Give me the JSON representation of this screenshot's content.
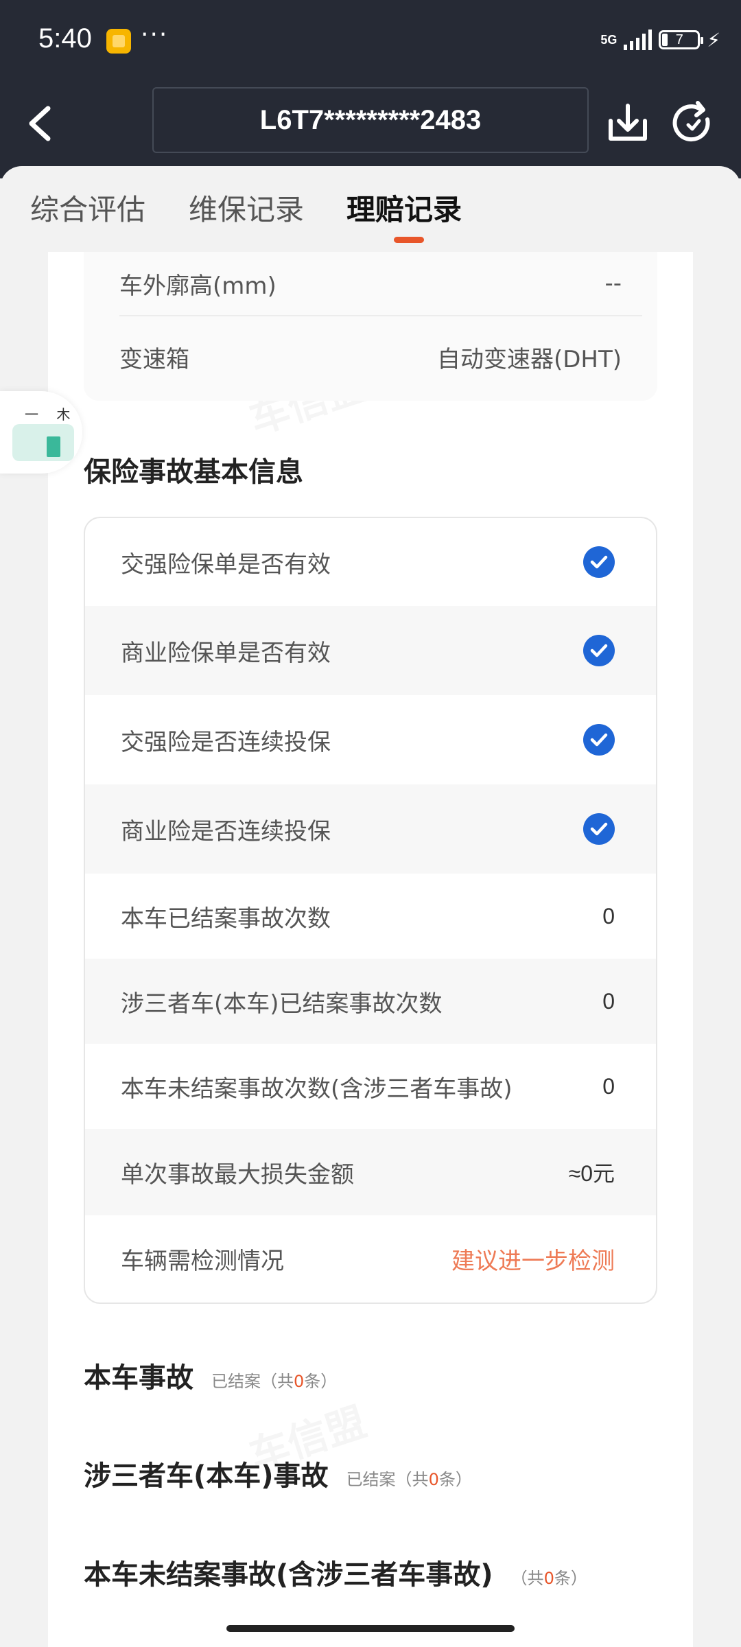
{
  "status_bar": {
    "time": "5:40",
    "dots": "···",
    "network": "5G",
    "battery": "7"
  },
  "header": {
    "vin": "L6T7*********2483"
  },
  "tabs": [
    {
      "label": "综合评估"
    },
    {
      "label": "维保记录"
    },
    {
      "label": "理赔记录"
    }
  ],
  "vehicle_info": {
    "rows": [
      {
        "label": "车外廓高(mm)",
        "value": "--"
      },
      {
        "label": "变速箱",
        "value": "自动变速器(DHT)"
      }
    ]
  },
  "floating_widget": {
    "text": "一 木"
  },
  "insurance": {
    "title": "保险事故基本信息",
    "rows": [
      {
        "label": "交强险保单是否有效",
        "type": "check"
      },
      {
        "label": "商业险保单是否有效",
        "type": "check"
      },
      {
        "label": "交强险是否连续投保",
        "type": "check"
      },
      {
        "label": "商业险是否连续投保",
        "type": "check"
      },
      {
        "label": "本车已结案事故次数",
        "value": "0"
      },
      {
        "label": "涉三者车(本车)已结案事故次数",
        "value": "0"
      },
      {
        "label": "本车未结案事故次数(含涉三者车事故)",
        "value": "0"
      },
      {
        "label": "单次事故最大损失金额",
        "value": "≈0元"
      },
      {
        "label": "车辆需检测情况",
        "value": "建议进一步检测"
      }
    ]
  },
  "accidents": [
    {
      "title": "本车事故",
      "sub_prefix": "已结案（共",
      "count": "0",
      "sub_suffix": "条）"
    },
    {
      "title": "涉三者车(本车)事故",
      "sub_prefix": "已结案（共",
      "count": "0",
      "sub_suffix": "条）"
    },
    {
      "title": "本车未结案事故(含涉三者车事故)",
      "sub_prefix": "（共",
      "count": "0",
      "sub_suffix": "条）"
    }
  ],
  "watermark_text": "车信盟",
  "colors": {
    "accent": "#e8562a",
    "check_blue": "#1f66d6",
    "header_bg": "#262a35",
    "warn": "#ee7a55"
  }
}
